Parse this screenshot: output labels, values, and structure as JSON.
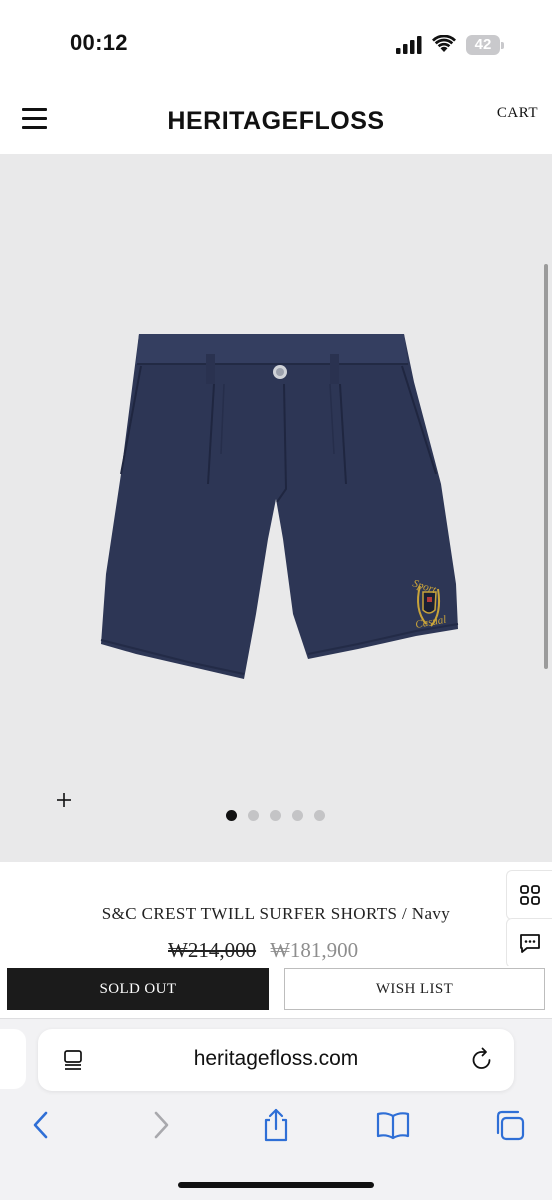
{
  "status_bar": {
    "time": "00:12",
    "battery": "42",
    "icons": [
      "cellular-signal-icon",
      "wifi-icon",
      "battery-icon"
    ]
  },
  "header": {
    "logo": "HERITAGEFLOSS",
    "cart_label": "CART",
    "menu_icon": "hamburger-menu-icon"
  },
  "gallery": {
    "image_description_icon": "navy-shorts-product-photo",
    "embroidery_lines": [
      "Sport",
      "Casual"
    ],
    "zoom_icon": "plus-icon",
    "slide_count": 5,
    "active_slide": 1,
    "background_color": "#e9e9ea"
  },
  "product": {
    "name": "S&C CREST TWILL SURFER SHORTS / Navy",
    "original_price": "₩214,000",
    "sale_price": "₩181,900"
  },
  "side_buttons": {
    "grid_icon": "grid-icon",
    "chat_icon": "chat-bubble-icon"
  },
  "actions": {
    "sold_out_label": "SOLD OUT",
    "wish_list_label": "WISH LIST"
  },
  "browser": {
    "url": "heritagefloss.com",
    "toolbar_icons": [
      "back-icon",
      "forward-icon",
      "share-icon",
      "bookmarks-icon",
      "tabs-icon"
    ],
    "accent_color": "#2f6fd6"
  }
}
